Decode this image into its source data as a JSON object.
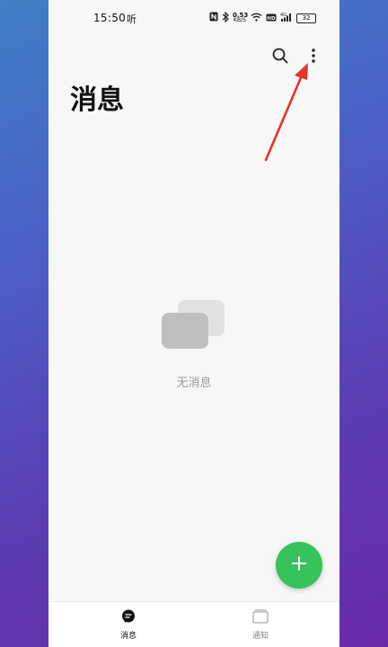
{
  "status_bar": {
    "time": "15:50",
    "extra": "听",
    "network_speed_value": "0.53",
    "network_speed_unit": "KB/S",
    "battery": "32"
  },
  "header": {
    "title": "消息"
  },
  "empty_state": {
    "text": "无消息"
  },
  "bottom_nav": {
    "items": [
      {
        "label": "消息",
        "active": true
      },
      {
        "label": "通知",
        "active": false
      }
    ]
  },
  "colors": {
    "accent": "#37c25c",
    "annotation_arrow": "#e8322a"
  },
  "icons": {
    "search": "search-icon",
    "more": "more-vertical-icon",
    "add": "plus-icon",
    "messages_tab": "chat-bubble-icon",
    "notifications_tab": "window-icon"
  }
}
